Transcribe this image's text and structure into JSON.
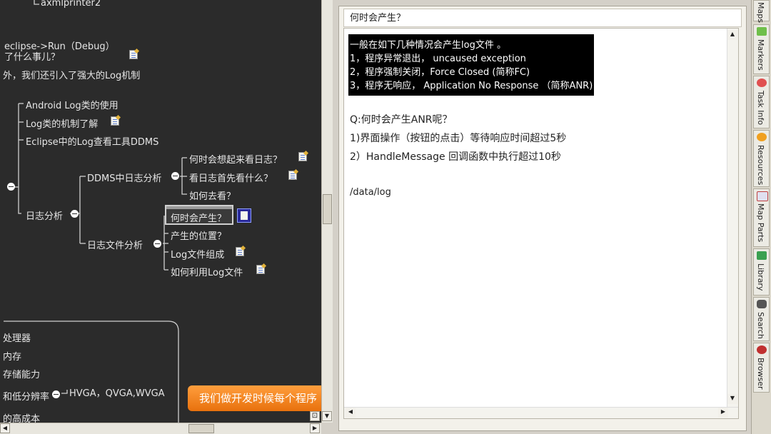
{
  "mindmap": {
    "top_item": "axmlprinter2",
    "run_text": "eclipse->Run（Debug）",
    "line1": "了什么事儿？",
    "line2": "外，我们还引入了强大的Log机制",
    "branch_items": [
      "Android Log类的使用",
      "Log类的机制了解",
      "Eclipse中的Log查看工具DDMS"
    ],
    "log_analysis": "日志分析",
    "ddms_analysis": "DDMS中日志分析",
    "ddms_children": [
      "何时会想起来看日志？",
      "看日志首先看什么？",
      "如何去看？"
    ],
    "file_analysis": "日志文件分析",
    "file_children": [
      "何时会产生？",
      "产生的位置？",
      "Log文件组成",
      "如何利用Log文件"
    ],
    "bottom_items": [
      "处理器",
      "内存",
      "存储能力",
      "和低分辨率",
      "的高成本"
    ],
    "resolutions": "HVGA，QVGA,WVGA",
    "orange_button": "我们做开发时候每个程序"
  },
  "notes": {
    "title": "何时会产生？",
    "highlight_lines": [
      "一般在如下几种情况会产生log文件 。",
      "1，程序异常退出，  uncaused exception",
      "2，程序强制关闭，Force Closed (简称FC)",
      "3，程序无响应，  Application No Response （简称ANR)"
    ],
    "question": "Q:何时会产生ANR呢？",
    "answer1": "1)界面操作（按钮的点击）等待响应时间超过5秒",
    "answer2": "2）HandleMessage 回调函数中执行超过10秒",
    "path": "/data/log"
  },
  "side_tabs": [
    "Maps",
    "Markers",
    "Task Info",
    "Resources",
    "Map Parts",
    "Library",
    "Search",
    "Browser"
  ]
}
